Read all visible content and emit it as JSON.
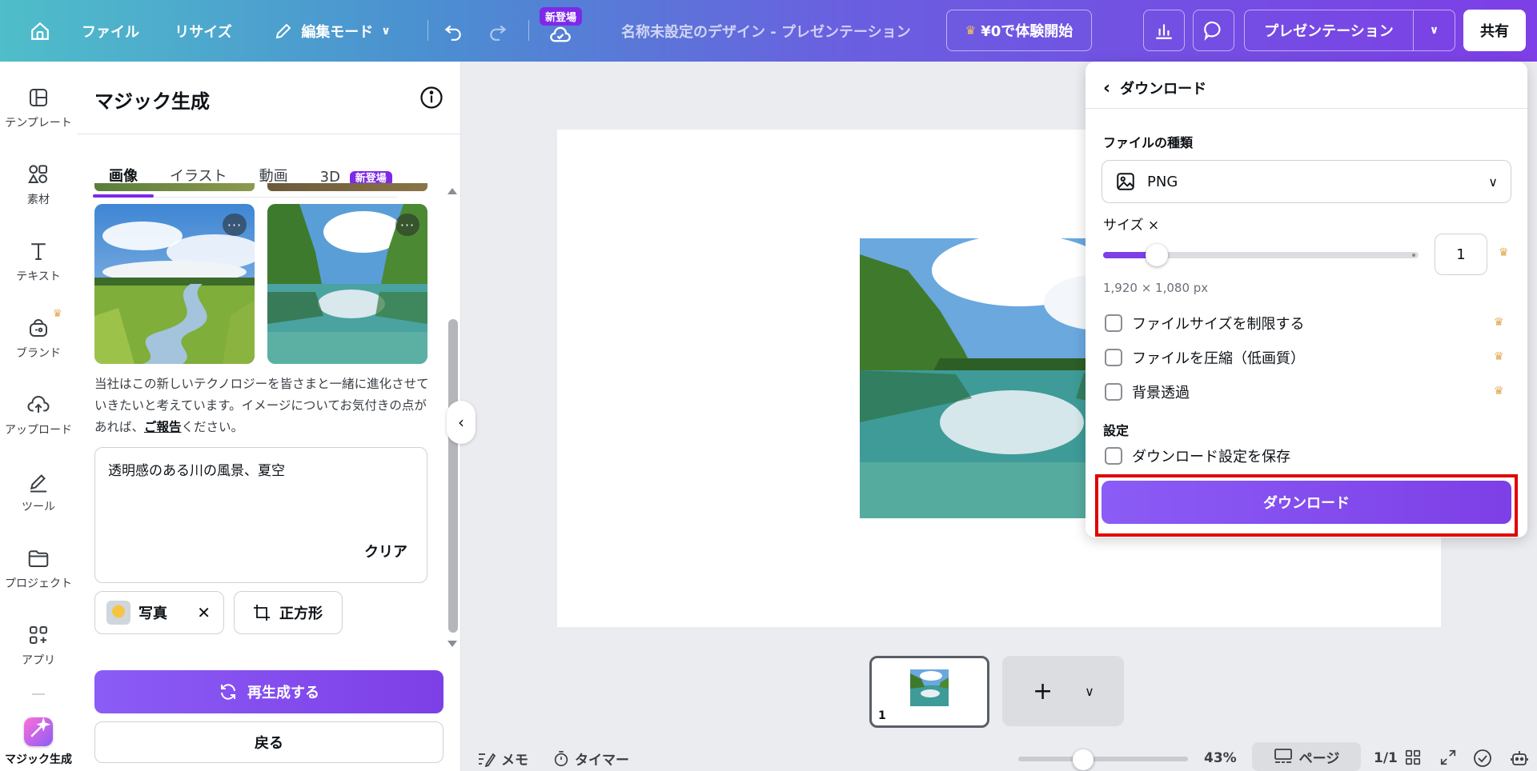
{
  "header": {
    "file": "ファイル",
    "resize": "リサイズ",
    "edit_mode": "編集モード",
    "new_badge": "新登場",
    "doc_title": "名称未設定のデザイン - プレゼンテーション",
    "trial": "¥0で体験開始",
    "present": "プレゼンテーション",
    "share": "共有"
  },
  "rail": {
    "items": [
      {
        "label": "テンプレート",
        "icon": "layout-icon"
      },
      {
        "label": "素材",
        "icon": "shapes-icon"
      },
      {
        "label": "テキスト",
        "icon": "text-icon"
      },
      {
        "label": "ブランド",
        "icon": "brand-icon"
      },
      {
        "label": "アップロード",
        "icon": "cloud-upload-icon"
      },
      {
        "label": "ツール",
        "icon": "pen-icon"
      },
      {
        "label": "プロジェクト",
        "icon": "folder-icon"
      },
      {
        "label": "アプリ",
        "icon": "apps-icon"
      },
      {
        "label": "マジック生成",
        "icon": "magic-icon"
      }
    ]
  },
  "panel": {
    "title": "マジック生成",
    "tabs": [
      "画像",
      "イラスト",
      "動画",
      "3D"
    ],
    "tab_badge": "新登場",
    "desc_pre": "当社はこの新しいテクノロジーを皆さまと一緒に進化させていきたいと考えています。イメージについてお気付きの点があれば、",
    "desc_link": "ご報告",
    "desc_post": "ください。",
    "prompt": "透明感のある川の風景、夏空",
    "clear": "クリア",
    "chip_photo": "写真",
    "chip_square": "正方形",
    "regenerate": "再生成する",
    "back": "戻る"
  },
  "download": {
    "title": "ダウンロード",
    "file_type_label": "ファイルの種類",
    "file_type": "PNG",
    "size_label": "サイズ ×",
    "size_value": "1",
    "size_fraction": 0.17,
    "dimensions": "1,920 × 1,080 px",
    "options": [
      "ファイルサイズを制限する",
      "ファイルを圧縮（低画質）",
      "背景透過"
    ],
    "settings_label": "設定",
    "save_settings": "ダウンロード設定を保存",
    "button": "ダウンロード"
  },
  "pages": {
    "page_number": "1"
  },
  "bottom": {
    "memo": "メモ",
    "timer": "タイマー",
    "zoom": "43%",
    "zoom_fraction": 0.38,
    "page_mode": "ページ",
    "page_count": "1/1"
  },
  "colors": {
    "accent": "#7d2ae8",
    "highlight": "#e00000",
    "crown": "#e2a64a"
  }
}
